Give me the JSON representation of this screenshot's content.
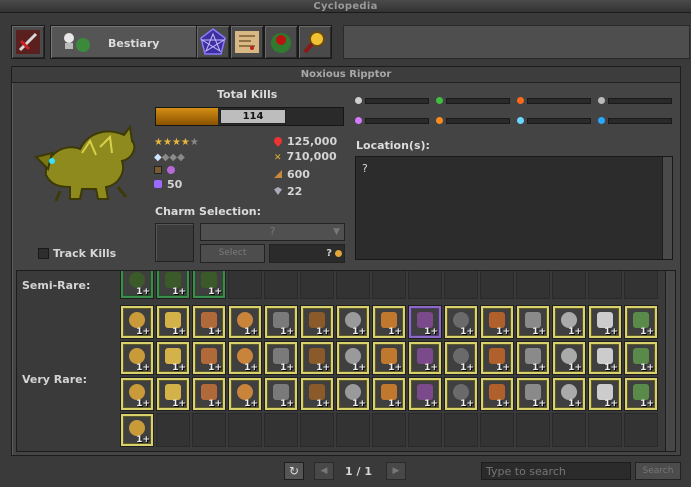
{
  "window": {
    "title": "Cyclopedia"
  },
  "tabs": [
    {
      "name": "items",
      "icon": "sword-icon"
    },
    {
      "name": "bestiary",
      "label": "Bestiary",
      "icon": "creature-icon",
      "active": true
    },
    {
      "name": "charms",
      "icon": "pentagram-icon"
    },
    {
      "name": "map",
      "icon": "map-icon"
    },
    {
      "name": "bosstiary",
      "icon": "boss-icon"
    },
    {
      "name": "character",
      "icon": "magnifier-icon"
    }
  ],
  "creature": {
    "name": "Noxious Ripptor",
    "total_kills_label": "Total Kills",
    "kills": "114",
    "kills_progress": 0.33,
    "difficulty_stars": {
      "filled": 4,
      "total": 5
    },
    "occurrence_diamonds": {
      "filled": 1,
      "total": 4
    },
    "charm_points": "50",
    "hitpoints": "125,000",
    "experience": "710,000",
    "speed": "600",
    "armor": "22",
    "track_kills_label": "Track Kills",
    "track_kills_checked": false
  },
  "charm": {
    "label": "Charm Selection:",
    "select_value": "?",
    "select_button": "Select",
    "cost": "?"
  },
  "resistances": [
    {
      "name": "physical",
      "color": "#d0d0d0"
    },
    {
      "name": "earth",
      "color": "#3fbf3f"
    },
    {
      "name": "fire",
      "color": "#ff6a1a"
    },
    {
      "name": "death",
      "color": "#bcbcbc"
    },
    {
      "name": "energy",
      "color": "#d27bff"
    },
    {
      "name": "holy",
      "color": "#ff8c1a"
    },
    {
      "name": "ice",
      "color": "#6ad7ff"
    },
    {
      "name": "heal",
      "color": "#2aa7ff"
    }
  ],
  "location": {
    "label": "Location(s):",
    "text": "?"
  },
  "loot": {
    "semi_rare_label": "Semi-Rare:",
    "very_rare_label": "Very Rare:",
    "count_label": "1+",
    "semi_rare_count": 3,
    "very_rare_count": 46
  },
  "pagination": {
    "page_text": "1 / 1",
    "search_placeholder": "Type to search",
    "search_button": "Search"
  }
}
